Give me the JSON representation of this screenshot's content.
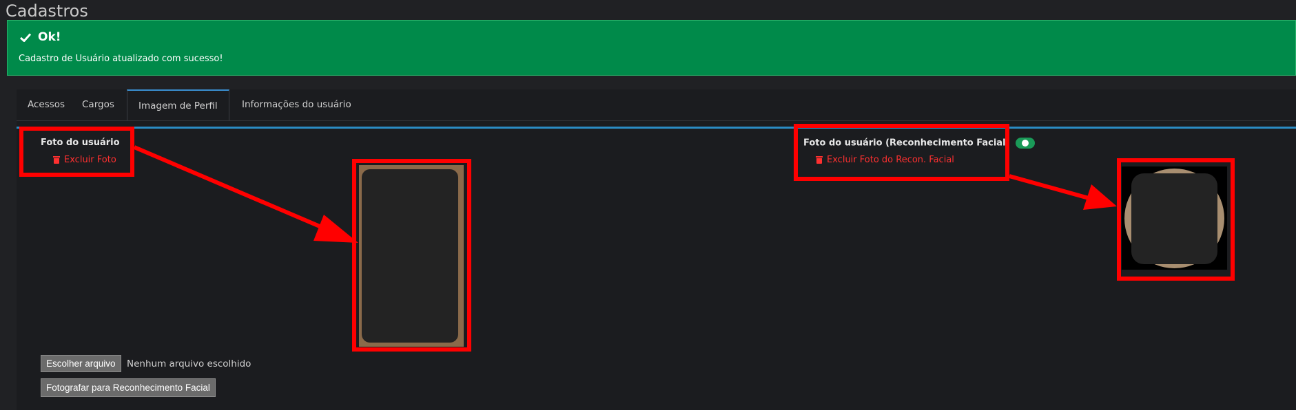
{
  "page": {
    "title": "Cadastros"
  },
  "alert": {
    "title": "Ok!",
    "message": "Cadastro de Usuário atualizado com sucesso!",
    "icon": "check-icon",
    "color": "#008a4a"
  },
  "tabs": [
    {
      "label": "Acessos",
      "active": false
    },
    {
      "label": "Cargos",
      "active": false
    },
    {
      "label": "Imagem de Perfil",
      "active": true
    },
    {
      "label": "Informações do usuário",
      "active": false
    }
  ],
  "profile_photo": {
    "label": "Foto do usuário",
    "delete_label": "Excluir Foto"
  },
  "facial_photo": {
    "label": "Foto do usuário (Reconhecimento Facial)",
    "delete_label": "Excluir Foto do Recon. Facial",
    "status_icon": "check-circle-icon"
  },
  "file_input": {
    "button_label": "Escolher arquivo",
    "status": "Nenhum arquivo escolhido"
  },
  "capture_button": {
    "label": "Fotografar para Reconhecimento Facial"
  },
  "colors": {
    "accent": "#2b8cc4",
    "danger": "#ff3030",
    "annotation": "#ff0000",
    "success": "#1a9a58"
  }
}
